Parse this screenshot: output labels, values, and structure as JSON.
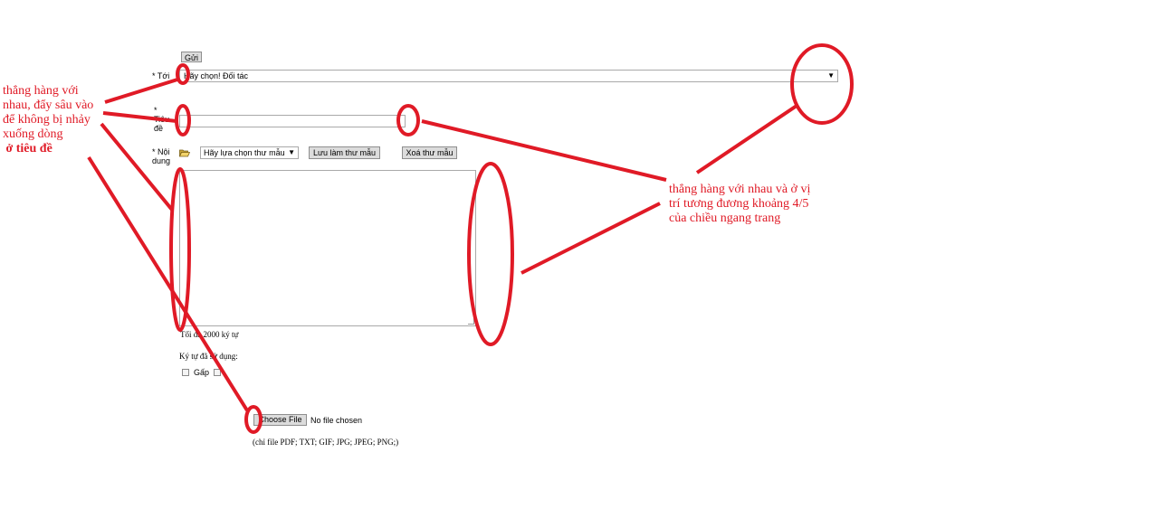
{
  "form": {
    "send_button": "Gửi",
    "to_label": "* Tới",
    "to_select_value": "Hãy chọn! Đối tác",
    "subject_label_lines": [
      "*",
      "Tiêu",
      "đề"
    ],
    "subject_value": "",
    "content_label_lines": [
      "* Nội",
      "dung"
    ],
    "template_select_value": "Hãy lựa chọn thư mẫu",
    "save_template_button": "Lưu làm thư mẫu",
    "delete_template_button": "Xoá thư mẫu",
    "max_chars_text": "Tối đa 2000 ký tự",
    "chars_used_text": "Ký tự đã sử dụng:",
    "urgent_label": "Gấp",
    "choose_file_button": "Choose File",
    "no_file_text": "No file chosen",
    "file_types_note": "(chỉ file PDF; TXT; GIF; JPG; JPEG; PNG;)"
  },
  "annotations": {
    "left_note_lines": [
      "thẳng hàng với",
      "nhau, đẩy sâu vào",
      "để không bị nhảy",
      "xuống dòng",
      " ở tiêu đề"
    ],
    "right_note_lines": [
      "thẳng hàng với nhau và ở vị",
      "trí tương đương khoảng 4/5",
      "của chiều ngang trang"
    ],
    "color": "#e01a26"
  },
  "icons": {
    "template_icon": "folder-open-icon",
    "select_arrow": "triangle-down-icon"
  }
}
